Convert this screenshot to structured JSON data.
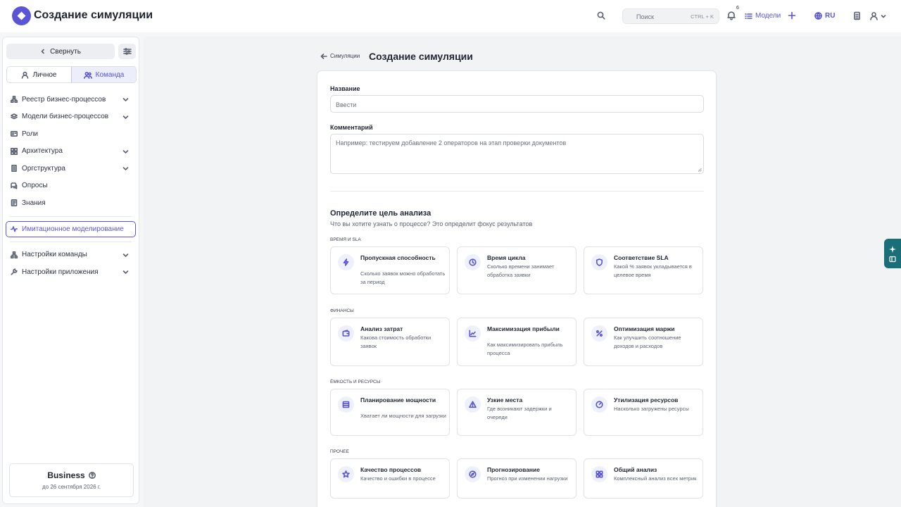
{
  "header": {
    "title": "Создание симуляции",
    "search_placeholder": "Поиск",
    "search_shortcut": "CTRL + K",
    "notifications_count": "6",
    "models_label": "Модели",
    "language": "RU"
  },
  "sidebar": {
    "collapse_label": "Свернуть",
    "tabs": [
      {
        "label": "Личное",
        "active": false
      },
      {
        "label": "Команда",
        "active": true
      }
    ],
    "items": [
      {
        "label": "Реестр бизнес-процессов",
        "icon": "network-icon",
        "expandable": true
      },
      {
        "label": "Модели бизнес-процессов",
        "icon": "layers-icon",
        "expandable": true
      },
      {
        "label": "Роли",
        "icon": "id-card-icon",
        "expandable": false
      },
      {
        "label": "Архитектура",
        "icon": "grid-icon",
        "expandable": true
      },
      {
        "label": "Оргструктура",
        "icon": "building-icon",
        "expandable": true
      },
      {
        "label": "Опросы",
        "icon": "chat-icon",
        "expandable": false
      },
      {
        "label": "Знания",
        "icon": "book-icon",
        "expandable": false
      },
      {
        "label": "Имитационное моделирование",
        "icon": "activity-icon",
        "expandable": false,
        "active": true
      },
      {
        "label": "Настройки команды",
        "icon": "team-settings-icon",
        "expandable": true
      },
      {
        "label": "Настройки приложения",
        "icon": "wrench-icon",
        "expandable": true
      }
    ],
    "plan": {
      "name": "Business",
      "until": "до 26 сентября 2026 г."
    }
  },
  "main": {
    "breadcrumb": "Симуляции",
    "title": "Создание симуляции",
    "form": {
      "name_label": "Название",
      "name_placeholder": "Ввести",
      "comment_label": "Комментарий",
      "comment_placeholder": "Например: тестируем добавление 2 операторов на этап проверки документов"
    },
    "goal": {
      "title": "Определите цель анализа",
      "subtitle": "Что вы хотите узнать о процессе? Это определит фокус результатов",
      "categories": [
        {
          "name": "Время и SLA",
          "options": [
            {
              "title": "Пропускная способность",
              "desc": "Сколько заявок можно обработать за период",
              "icon": "bolt-icon"
            },
            {
              "title": "Время цикла",
              "desc": "Сколько времени занимает обработка заявки",
              "icon": "clock-icon"
            },
            {
              "title": "Соответствие SLA",
              "desc": "Какой % заявок укладывается в целевое время",
              "icon": "shield-icon"
            }
          ]
        },
        {
          "name": "Финансы",
          "options": [
            {
              "title": "Анализ затрат",
              "desc": "Какова стоимость обработки заявок",
              "icon": "wallet-icon"
            },
            {
              "title": "Максимизация прибыли",
              "desc": "Как максимизировать прибыль процесса",
              "icon": "trend-icon"
            },
            {
              "title": "Оптимизация маржи",
              "desc": "Как улучшить соотношение доходов и расходов",
              "icon": "percent-icon"
            }
          ]
        },
        {
          "name": "Ёмкость и ресурсы",
          "options": [
            {
              "title": "Планирование мощности",
              "desc": "Хватает ли мощности для загрузки",
              "icon": "server-icon"
            },
            {
              "title": "Узкие места",
              "desc": "Где возникают задержки и очереди",
              "icon": "warning-icon"
            },
            {
              "title": "Утилизация ресурсов",
              "desc": "Насколько загружены ресурсы",
              "icon": "gauge-icon"
            }
          ]
        },
        {
          "name": "Прочее",
          "options": [
            {
              "title": "Качество процессов",
              "desc": "Качество и ошибки в процессе",
              "icon": "star-icon"
            },
            {
              "title": "Прогнозирование",
              "desc": "Прогноз при изменении нагрузки",
              "icon": "compass-icon"
            },
            {
              "title": "Общий анализ",
              "desc": "Комплексный анализ всех метрик",
              "icon": "apps-icon"
            }
          ]
        }
      ]
    }
  },
  "colors": {
    "accent": "#5a55d6",
    "ai_tab": "#1a6e78"
  }
}
